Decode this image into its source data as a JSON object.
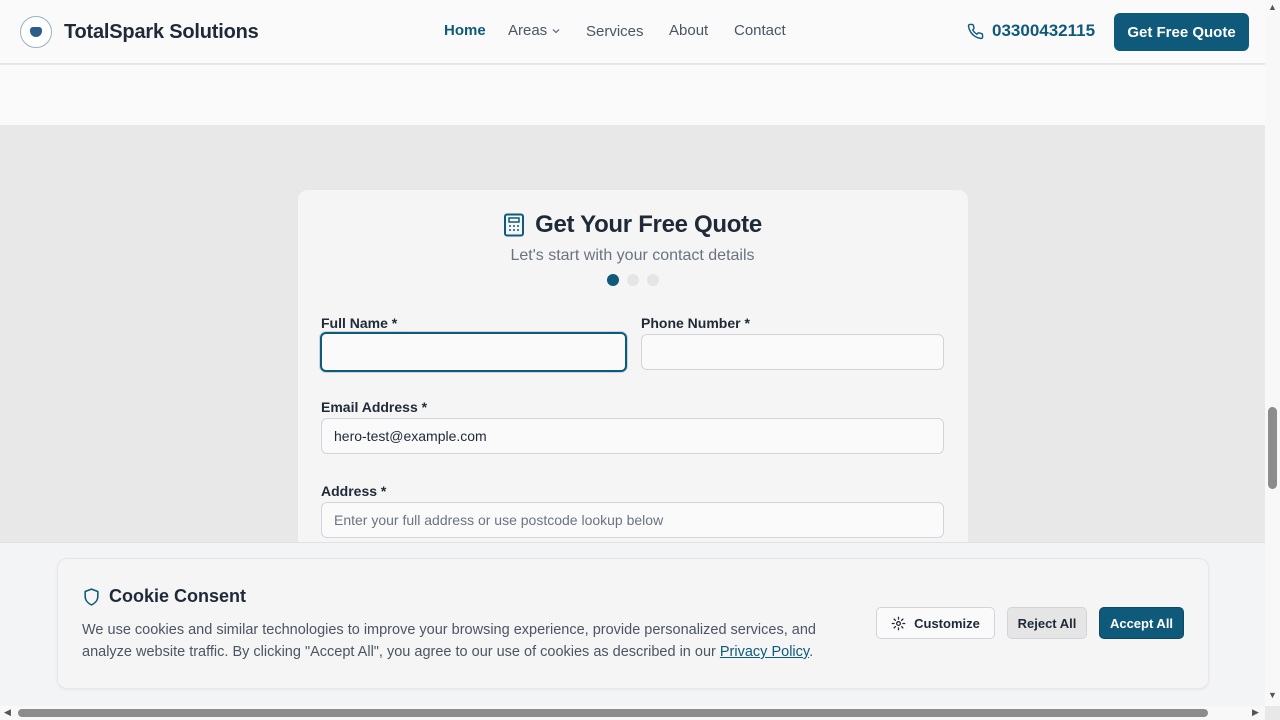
{
  "header": {
    "brand": "TotalSpark Solutions",
    "nav": [
      "Home",
      "Areas",
      "Services",
      "About",
      "Contact"
    ],
    "phone": "03300432115",
    "cta": "Get Free Quote"
  },
  "quote_form": {
    "title": "Get Your Free Quote",
    "subtitle": "Let's start with your contact details",
    "steps_total": 3,
    "step_current": 1,
    "full_name_label": "Full Name *",
    "full_name_value": "",
    "phone_label": "Phone Number *",
    "phone_value": "",
    "email_label": "Email Address *",
    "email_value": "hero-test@example.com",
    "address_label": "Address *",
    "address_placeholder": "Enter your full address or use postcode lookup below"
  },
  "cookie": {
    "title": "Cookie Consent",
    "text": "We use cookies and similar technologies to improve your browsing experience, provide personalized services, and analyze website traffic. By clicking \"Accept All\", you agree to our use of cookies as described in our ",
    "link": "Privacy Policy",
    "text_end": ".",
    "customize": "Customize",
    "reject": "Reject All",
    "accept": "Accept All"
  },
  "colors": {
    "accent": "#0f5a7a"
  }
}
